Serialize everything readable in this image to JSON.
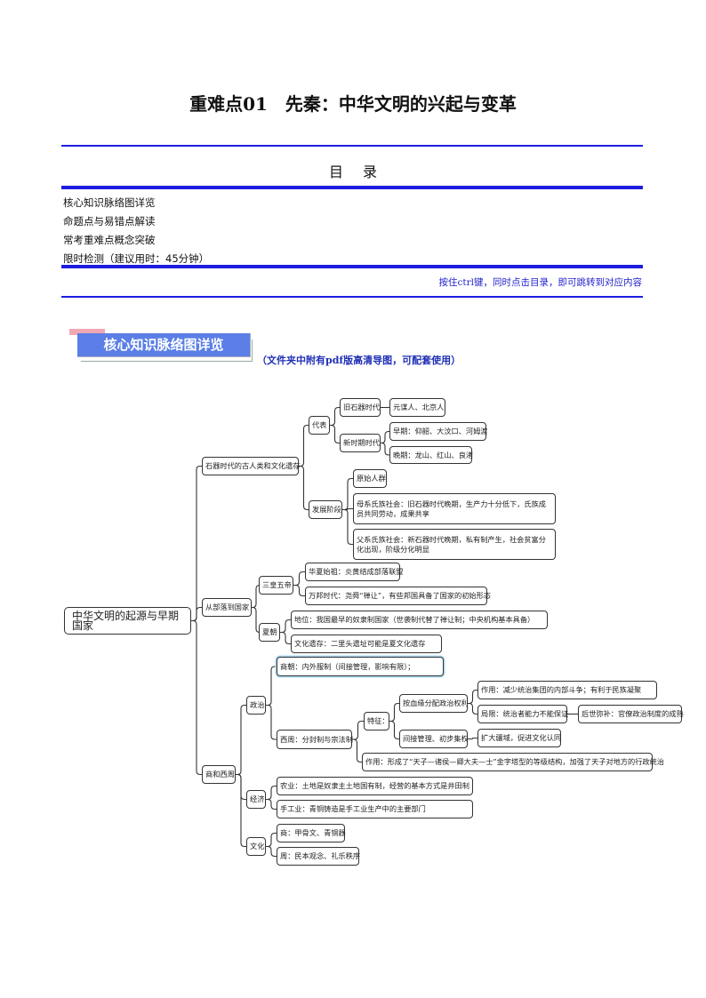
{
  "header": {
    "title": "重难点01　先秦：中华文明的兴起与变革",
    "toc_heading": "目录",
    "toc_items": [
      "核心知识脉络图详览",
      "命题点与易错点解读",
      "常考重难点概念突破",
      "限时检测（建议用时：45分钟）"
    ],
    "ctrl_note": "按住ctrl键，同时点击目录，即可跳转到对应内容"
  },
  "section": {
    "label": "核心知识脉络图详览",
    "subtitle": "（文件夹中附有pdf版高清导图，可配套使用）"
  },
  "colors": {
    "rule": "#1d1de0",
    "section_bg": "#5b7fe6",
    "section_tab": "#f0a8b4",
    "highlight": "#a9d6f0"
  },
  "mindmap": {
    "nodes": [
      {
        "id": "root",
        "parent": null,
        "text": "中华文明的起源与早期国家"
      },
      {
        "id": "stone",
        "parent": "root",
        "text": "石器时代的古人类和文化遗存"
      },
      {
        "id": "tribe",
        "parent": "root",
        "text": "从部落到国家"
      },
      {
        "id": "shangzhou",
        "parent": "root",
        "text": "商和西周"
      },
      {
        "id": "rep",
        "parent": "stone",
        "text": "代表"
      },
      {
        "id": "stage",
        "parent": "stone",
        "text": "发展阶段"
      },
      {
        "id": "paleo",
        "parent": "rep",
        "text": "旧石器时代"
      },
      {
        "id": "neo",
        "parent": "rep",
        "text": "新时期时代"
      },
      {
        "id": "yuanmou",
        "parent": "paleo",
        "text": "元谋人、北京人"
      },
      {
        "id": "early",
        "parent": "neo",
        "text": "早期：仰韶、大汶口、河姆渡"
      },
      {
        "id": "late",
        "parent": "neo",
        "text": "晚期：龙山、红山、良渚"
      },
      {
        "id": "primitive",
        "parent": "stage",
        "text": "原始人群"
      },
      {
        "id": "matri",
        "parent": "stage",
        "text": "母系氏族社会：旧石器时代晚期，生产力十分低下，氏族成员共同劳动，成果共享"
      },
      {
        "id": "patri",
        "parent": "stage",
        "text": "父系氏族社会：新石器时代晚期，私有制产生，社会贫富分化出现，阶级分化明显"
      },
      {
        "id": "sanhuang",
        "parent": "tribe",
        "text": "三皇五帝"
      },
      {
        "id": "xia",
        "parent": "tribe",
        "text": "夏朝"
      },
      {
        "id": "huaxia",
        "parent": "sanhuang",
        "text": "华夏始祖：炎黄结成部落联盟"
      },
      {
        "id": "wanbang",
        "parent": "sanhuang",
        "text": "万邦时代：尧舜“禅让”，有些邦国具备了国家的初始形态"
      },
      {
        "id": "status",
        "parent": "xia",
        "text": "地位：我国最早的奴隶制国家（世袭制代替了禅让制；中央机构基本具备）"
      },
      {
        "id": "erlitou",
        "parent": "xia",
        "text": "文化遗存：二里头遗址可能是夏文化遗存"
      },
      {
        "id": "politics",
        "parent": "shangzhou",
        "text": "政治"
      },
      {
        "id": "economy",
        "parent": "shangzhou",
        "text": "经济"
      },
      {
        "id": "culture",
        "parent": "shangzhou",
        "text": "文化"
      },
      {
        "id": "shang_pol",
        "parent": "politics",
        "text": "商朝：内外服制（间接管理，影响有限）；"
      },
      {
        "id": "xizhou",
        "parent": "politics",
        "text": "西周：分封制与宗法制"
      },
      {
        "id": "feature",
        "parent": "xizhou",
        "text": "特征："
      },
      {
        "id": "role_zhou",
        "parent": "xizhou",
        "text": "作用：形成了“天子—诸侯—卿大夫—士”金字塔型的等级结构，加强了天子对地方的行政统治"
      },
      {
        "id": "blood",
        "parent": "feature",
        "text": "按血缘分配政治权利"
      },
      {
        "id": "indirect",
        "parent": "feature",
        "text": "间接管理、初步集权"
      },
      {
        "id": "role_blood",
        "parent": "blood",
        "text": "作用：减少统治集团的内部斗争；有利于民族凝聚"
      },
      {
        "id": "limit",
        "parent": "blood",
        "text": "局限：统治者能力不能保证"
      },
      {
        "id": "later",
        "parent": "limit",
        "text": "后世弥补：官僚政治制度的成熟"
      },
      {
        "id": "expand",
        "parent": "indirect",
        "text": "扩大疆域，促进文化认同"
      },
      {
        "id": "agri",
        "parent": "economy",
        "text": "农业：土地是奴隶主土地国有制，经营的基本方式是井田制"
      },
      {
        "id": "craft",
        "parent": "economy",
        "text": "手工业：青铜铸造是手工业生产中的主要部门"
      },
      {
        "id": "shang_cul",
        "parent": "culture",
        "text": "商：甲骨文、青铜器"
      },
      {
        "id": "zhou_cul",
        "parent": "culture",
        "text": "周：民本观念、礼乐秩序"
      }
    ]
  }
}
